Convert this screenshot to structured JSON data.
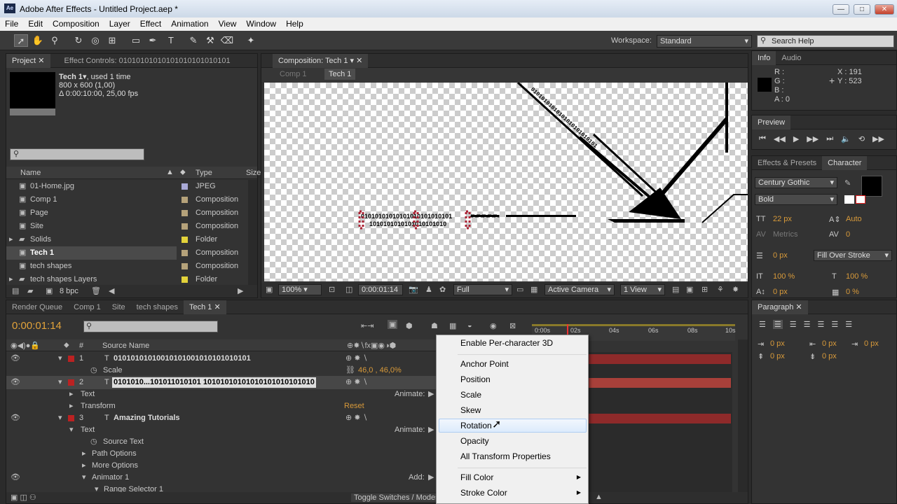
{
  "window": {
    "title": "Adobe After Effects - Untitled Project.aep *",
    "app_icon": "Ae",
    "min": "—",
    "max": "□",
    "close": "✕"
  },
  "menu": [
    "File",
    "Edit",
    "Composition",
    "Layer",
    "Effect",
    "Animation",
    "View",
    "Window",
    "Help"
  ],
  "toolbar": {
    "workspace_label": "Workspace:",
    "workspace_value": "Standard",
    "search_placeholder": "Search Help"
  },
  "project": {
    "tab_project": "Project",
    "tab_effects": "Effect Controls: 01010101010101010101010101",
    "item_name": "Tech 1",
    "item_used": ", used 1 time",
    "item_size": "800 x 600 (1,00)",
    "item_duration": "Δ 0:00:10:00, 25,00 fps",
    "col_name": "Name",
    "col_type": "Type",
    "col_size": "Size",
    "items": [
      {
        "name": "01-Home.jpg",
        "type": "JPEG",
        "color": "#a9a9d6",
        "icon": "image-icon"
      },
      {
        "name": "Comp 1",
        "type": "Composition",
        "color": "#b5a27a",
        "icon": "composition-icon"
      },
      {
        "name": "Page",
        "type": "Composition",
        "color": "#b5a27a",
        "icon": "composition-icon"
      },
      {
        "name": "Site",
        "type": "Composition",
        "color": "#b5a27a",
        "icon": "composition-icon"
      },
      {
        "name": "Solids",
        "type": "Folder",
        "color": "#e2d23a",
        "icon": "folder-icon"
      },
      {
        "name": "Tech 1",
        "type": "Composition",
        "color": "#b5a27a",
        "icon": "composition-icon"
      },
      {
        "name": "tech shapes",
        "type": "Composition",
        "color": "#b5a27a",
        "icon": "composition-icon"
      },
      {
        "name": "tech shapes Layers",
        "type": "Folder",
        "color": "#e2d23a",
        "icon": "folder-icon"
      }
    ],
    "bpc": "8 bpc"
  },
  "composition": {
    "tab": "Composition: Tech 1",
    "crumb1": "Comp 1",
    "crumb2": "Tech 1",
    "text_line1": "01010101010101010101010101",
    "text_line2": "1010101010101010101010",
    "diag_text": "01010101010101010101010101",
    "zoom": "100%",
    "timecode": "0:00:01:14",
    "resolution": "Full",
    "camera": "Active Camera",
    "views": "1 View"
  },
  "info": {
    "tab_info": "Info",
    "tab_audio": "Audio",
    "r": "R :",
    "g": "G :",
    "b": "B :",
    "a": "A : 0",
    "x": "X : 191",
    "y": "Y : 523"
  },
  "preview": {
    "tab": "Preview"
  },
  "character": {
    "tab_effects": "Effects & Presets",
    "tab_char": "Character",
    "font": "Century Gothic",
    "style": "Bold",
    "size": "22 px",
    "leading": "Auto",
    "kerning": "Metrics",
    "tracking": "0",
    "stroke": "0 px",
    "stroke_mode": "Fill Over Stroke",
    "vscale": "100 %",
    "hscale": "100 %",
    "baseline": "0 px",
    "tsume": "0 %"
  },
  "paragraph": {
    "tab": "Paragraph",
    "v1": "0 px",
    "v2": "0 px",
    "v3": "0 px",
    "v4": "0 px",
    "v5": "0 px"
  },
  "timeline": {
    "tabs": [
      "Render Queue",
      "Comp 1",
      "Site",
      "tech shapes",
      "Tech 1"
    ],
    "timecode": "0:00:01:14",
    "col_num": "#",
    "col_source": "Source Name",
    "ruler": [
      "0:00s",
      "02s",
      "04s",
      "06s",
      "08s",
      "10s"
    ],
    "layers": [
      {
        "num": "1",
        "name": "01010101010010101001010101010101",
        "sub": "Scale",
        "sub_value": "46,0 , 46,0%"
      },
      {
        "num": "2",
        "name": "0101010...101011010101 10101010101010101010101010"
      },
      {
        "num": "3",
        "name": "Amazing Tutorials"
      }
    ],
    "text_label": "Text",
    "transform_label": "Transform",
    "reset": "Reset",
    "animate": "Animate:",
    "source_text": "Source Text",
    "path_options": "Path Options",
    "more_options": "More Options",
    "animator": "Animator 1",
    "add": "Add:",
    "range_selector": "Range Selector 1",
    "toggle": "Toggle Switches / Modes"
  },
  "context_menu": {
    "items": [
      "Enable Per-character 3D",
      "Anchor Point",
      "Position",
      "Scale",
      "Skew",
      "Rotation",
      "Opacity",
      "All Transform Properties",
      "Fill Color",
      "Stroke Color"
    ],
    "highlighted": "Rotation"
  }
}
